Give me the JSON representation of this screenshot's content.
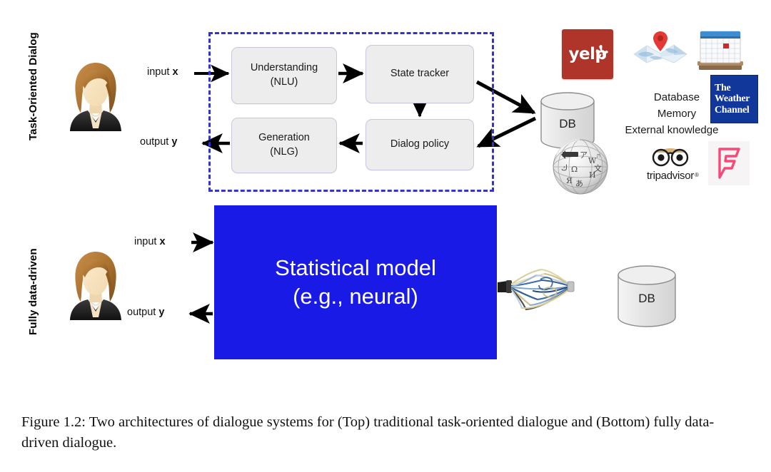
{
  "figure": {
    "caption": "Figure 1.2: Two architectures of dialogue systems for (Top) traditional task-oriented dialogue and (Bottom) fully data-driven dialogue."
  },
  "rows": {
    "top": {
      "label": "Task-Oriented Dialog",
      "avatar_name": "user-avatar",
      "input_label_prefix": "input ",
      "input_label_var": "x",
      "output_label_prefix": "output ",
      "output_label_var": "y",
      "modules": [
        {
          "id": "nlu",
          "line1": "Understanding",
          "line2": "(NLU)"
        },
        {
          "id": "state_tracker",
          "line1": "State tracker",
          "line2": ""
        },
        {
          "id": "dialog_policy",
          "line1": "Dialog policy",
          "line2": ""
        },
        {
          "id": "nlg",
          "line1": "Generation",
          "line2": "(NLG)"
        }
      ],
      "db_label": "DB",
      "knowledge_lines": [
        "Database",
        "Memory",
        "External knowledge"
      ],
      "logos": [
        {
          "id": "yelp",
          "name": "yelp-logo",
          "text": "yelp"
        },
        {
          "id": "maps",
          "name": "maps-logo",
          "text": ""
        },
        {
          "id": "calendar",
          "name": "calendar-logo",
          "text": ""
        },
        {
          "id": "weather",
          "name": "weather-channel-logo",
          "line1": "The",
          "line2": "Weather",
          "line3": "Channel"
        },
        {
          "id": "wikipedia",
          "name": "wikipedia-logo",
          "text": ""
        },
        {
          "id": "tripadvisor",
          "name": "tripadvisor-logo",
          "text": "tripadvisor"
        },
        {
          "id": "foursquare",
          "name": "foursquare-logo",
          "text": ""
        }
      ]
    },
    "bottom": {
      "label": "Fully data-driven",
      "avatar_name": "user-avatar",
      "input_label_prefix": "input ",
      "input_label_var": "x",
      "output_label_prefix": "output ",
      "output_label_var": "y",
      "model_line1": "Statistical model",
      "model_line2": "(e.g., neural)",
      "db_label": "DB"
    }
  },
  "colors": {
    "dashed_border": "#3434cc",
    "model_block": "#1a1ae6",
    "module_fill": "#ededee",
    "module_border": "#c9c6dd",
    "yelp_red": "#af3429",
    "weather_blue": "#11379b",
    "foursquare_pink": "#f94877",
    "arrow": "#000000"
  }
}
